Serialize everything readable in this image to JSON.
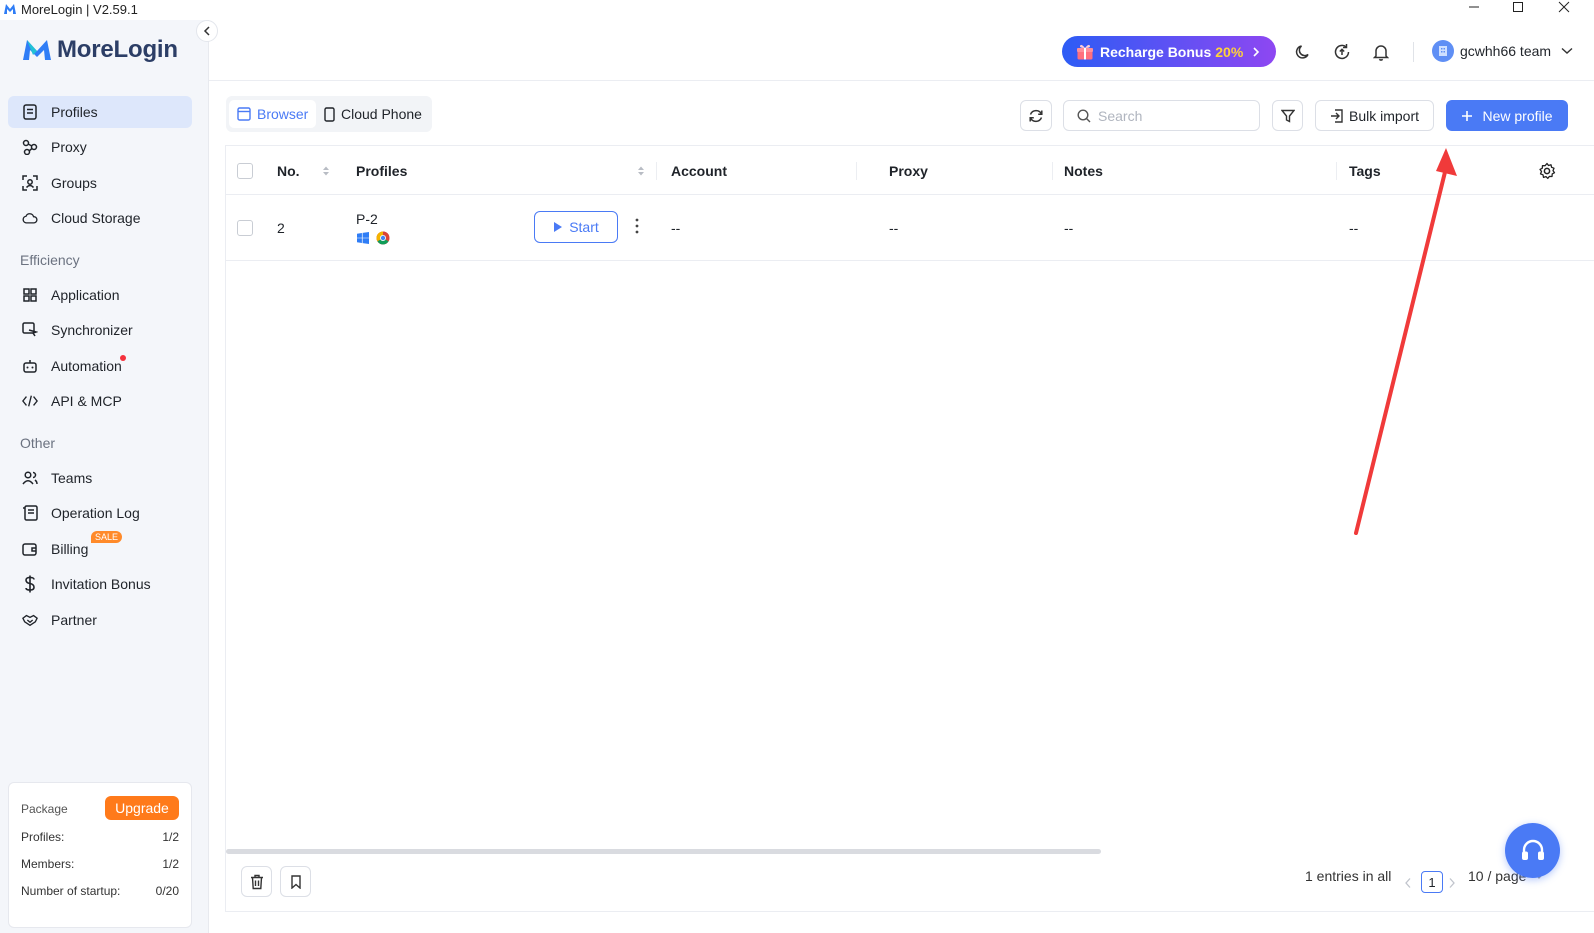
{
  "window": {
    "title": "MoreLogin | V2.59.1"
  },
  "brand": {
    "name": "MoreLogin"
  },
  "sidebar": {
    "items": [
      {
        "label": "Profiles"
      },
      {
        "label": "Proxy"
      },
      {
        "label": "Groups"
      },
      {
        "label": "Cloud Storage"
      }
    ],
    "efficiency_label": "Efficiency",
    "efficiency_items": [
      {
        "label": "Application"
      },
      {
        "label": "Synchronizer"
      },
      {
        "label": "Automation"
      },
      {
        "label": "API & MCP"
      }
    ],
    "other_label": "Other",
    "other_items": [
      {
        "label": "Teams"
      },
      {
        "label": "Operation Log"
      },
      {
        "label": "Billing",
        "badge": "SALE"
      },
      {
        "label": "Invitation Bonus"
      },
      {
        "label": "Partner"
      }
    ]
  },
  "package": {
    "title": "Package",
    "upgrade_label": "Upgrade",
    "rows": [
      {
        "label": "Profiles:",
        "value": "1/2"
      },
      {
        "label": "Members:",
        "value": "1/2"
      },
      {
        "label": "Number of startup:",
        "value": "0/20"
      }
    ]
  },
  "header": {
    "recharge_label": "Recharge Bonus",
    "recharge_pct": "20%",
    "team_name": "gcwhh66 team"
  },
  "toolbar": {
    "tab_browser": "Browser",
    "tab_cloud_phone": "Cloud Phone",
    "search_placeholder": "Search",
    "bulk_import_label": "Bulk import",
    "new_profile_label": "New profile"
  },
  "table": {
    "columns": {
      "no": "No.",
      "profiles": "Profiles",
      "account": "Account",
      "proxy": "Proxy",
      "notes": "Notes",
      "tags": "Tags"
    },
    "rows": [
      {
        "no": "2",
        "profile": "P-2",
        "start_label": "Start",
        "account": "--",
        "proxy": "--",
        "notes": "--",
        "tags": "--"
      }
    ]
  },
  "footer": {
    "entries_text": "1 entries in all",
    "current_page": "1",
    "page_size": "10 / page"
  },
  "colors": {
    "accent": "#4a7af5",
    "upgrade": "#ff7a1a",
    "annotation_arrow": "#f03a3a"
  }
}
